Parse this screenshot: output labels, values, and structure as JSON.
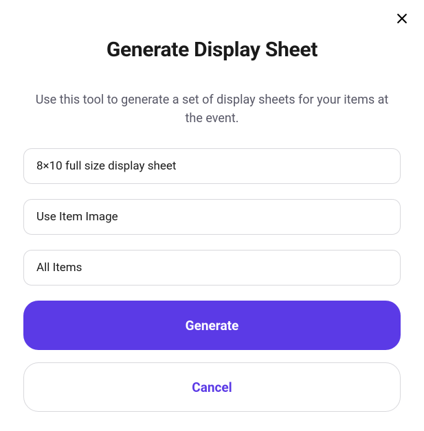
{
  "modal": {
    "title": "Generate Display Sheet",
    "description": "Use this tool to generate a set of display sheets for your items at the event.",
    "fields": {
      "size": "8×10 full size display sheet",
      "image_source": "Use Item Image",
      "item_filter": "All Items"
    },
    "buttons": {
      "generate": "Generate",
      "cancel": "Cancel"
    }
  }
}
